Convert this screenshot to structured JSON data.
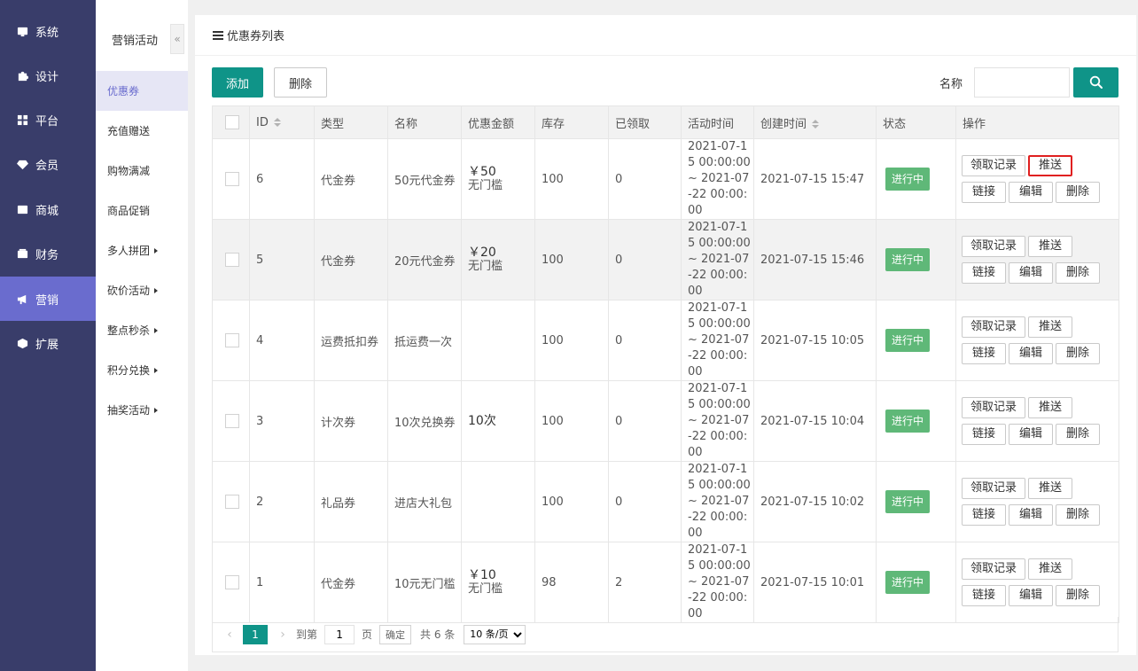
{
  "main_nav": [
    {
      "label": "系统",
      "icon": "monitor-icon"
    },
    {
      "label": "设计",
      "icon": "puzzle-icon"
    },
    {
      "label": "平台",
      "icon": "grid-icon"
    },
    {
      "label": "会员",
      "icon": "diamond-icon"
    },
    {
      "label": "商城",
      "icon": "mail-icon"
    },
    {
      "label": "财务",
      "icon": "wallet-icon"
    },
    {
      "label": "营销",
      "icon": "megaphone-icon",
      "active": true
    },
    {
      "label": "扩展",
      "icon": "cube-icon"
    }
  ],
  "sub_nav": {
    "title": "营销活动",
    "collapse_glyph": "«",
    "items": [
      {
        "label": "优惠券",
        "active": true
      },
      {
        "label": "充值赠送"
      },
      {
        "label": "购物满减"
      },
      {
        "label": "商品促销"
      },
      {
        "label": "多人拼团",
        "has_submenu": true
      },
      {
        "label": "砍价活动",
        "has_submenu": true
      },
      {
        "label": "整点秒杀",
        "has_submenu": true
      },
      {
        "label": "积分兑换",
        "has_submenu": true
      },
      {
        "label": "抽奖活动",
        "has_submenu": true
      }
    ]
  },
  "panel": {
    "title": "优惠券列表",
    "add_label": "添加",
    "delete_label": "删除",
    "search_label": "名称",
    "search_value": ""
  },
  "table": {
    "headers": [
      "ID",
      "类型",
      "名称",
      "优惠金额",
      "库存",
      "已领取",
      "活动时间",
      "创建时间",
      "状态",
      "操作"
    ],
    "ops_labels": {
      "records": "领取记录",
      "push": "推送",
      "link": "链接",
      "edit": "编辑",
      "delete": "删除"
    },
    "rows": [
      {
        "id": "6",
        "type": "代金券",
        "name": "50元代金券",
        "amount": "￥50",
        "amount_note": "无门槛",
        "stock": "100",
        "received": "0",
        "period": "2021-07-15 00:00:00 ~ 2021-07-22 00:00:00",
        "created": "2021-07-15 15:47",
        "status": "进行中"
      },
      {
        "id": "5",
        "type": "代金券",
        "name": "20元代金券",
        "amount": "￥20",
        "amount_note": "无门槛",
        "stock": "100",
        "received": "0",
        "period": "2021-07-15 00:00:00 ~ 2021-07-22 00:00:00",
        "created": "2021-07-15 15:46",
        "status": "进行中"
      },
      {
        "id": "4",
        "type": "运费抵扣券",
        "name": "抵运费一次",
        "amount": "",
        "amount_note": "",
        "stock": "100",
        "received": "0",
        "period": "2021-07-15 00:00:00 ~ 2021-07-22 00:00:00",
        "created": "2021-07-15 10:05",
        "status": "进行中"
      },
      {
        "id": "3",
        "type": "计次券",
        "name": "10次兑换券",
        "amount": "10次",
        "amount_note": "",
        "stock": "100",
        "received": "0",
        "period": "2021-07-15 00:00:00 ~ 2021-07-22 00:00:00",
        "created": "2021-07-15 10:04",
        "status": "进行中"
      },
      {
        "id": "2",
        "type": "礼品券",
        "name": "进店大礼包",
        "amount": "",
        "amount_note": "",
        "stock": "100",
        "received": "0",
        "period": "2021-07-15 00:00:00 ~ 2021-07-22 00:00:00",
        "created": "2021-07-15 10:02",
        "status": "进行中"
      },
      {
        "id": "1",
        "type": "代金券",
        "name": "10元无门槛",
        "amount": "￥10",
        "amount_note": "无门槛",
        "stock": "98",
        "received": "2",
        "period": "2021-07-15 00:00:00 ~ 2021-07-22 00:00:00",
        "created": "2021-07-15 10:01",
        "status": "进行中"
      }
    ]
  },
  "pager": {
    "prev": "‹",
    "current": "1",
    "next": "›",
    "goto_label": "到第",
    "goto_value": "1",
    "page_unit": "页",
    "confirm": "确定",
    "total": "共 6 条",
    "page_size": "10 条/页"
  },
  "colors": {
    "nav_bg": "#393d6a",
    "nav_active": "#6a6cce",
    "primary": "#0f9488",
    "status_green": "#5fb878",
    "highlight_red": "#e02020"
  }
}
